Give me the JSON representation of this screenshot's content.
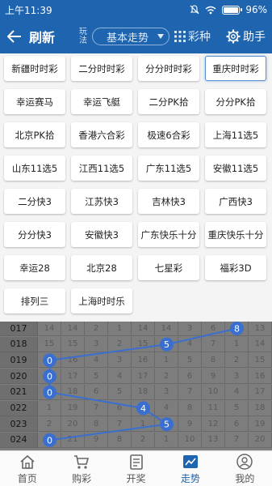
{
  "status_bar": {
    "time": "上午11:39",
    "battery": "96%",
    "battery_level": 0.96
  },
  "nav": {
    "title": "刷新",
    "play_label_top": "玩",
    "play_label_bottom": "法",
    "play_selected": "基本走势",
    "lottery_label": "彩种",
    "helper_label": "助手"
  },
  "lotteries": [
    "新疆时时彩",
    "二分时时彩",
    "分分时时彩",
    "重庆时时彩",
    "幸运赛马",
    "幸运飞艇",
    "二分PK拾",
    "分分PK拾",
    "北京PK拾",
    "香港六合彩",
    "极速6合彩",
    "上海11选5",
    "山东11选5",
    "江西11选5",
    "广东11选5",
    "安徽11选5",
    "二分快3",
    "江苏快3",
    "吉林快3",
    "广西快3",
    "分分快3",
    "安徽快3",
    "广东快乐十分",
    "重庆快乐十分",
    "幸运28",
    "北京28",
    "七星彩",
    "福彩3D",
    "排列三",
    "上海时时乐"
  ],
  "selected_lottery": "重庆时时彩",
  "trend": {
    "rows": [
      {
        "issue": "017",
        "cells": [
          "14",
          "14",
          "2",
          "1",
          "14",
          "14",
          "3",
          "6",
          "8",
          "13"
        ],
        "hit": 8
      },
      {
        "issue": "018",
        "cells": [
          "15",
          "15",
          "3",
          "2",
          "15",
          "5",
          "4",
          "7",
          "1",
          "14"
        ],
        "hit": 5
      },
      {
        "issue": "019",
        "cells": [
          "0",
          "16",
          "4",
          "3",
          "16",
          "1",
          "5",
          "8",
          "2",
          "15"
        ],
        "hit": 0
      },
      {
        "issue": "020",
        "cells": [
          "0",
          "17",
          "5",
          "4",
          "17",
          "2",
          "6",
          "9",
          "3",
          "16"
        ],
        "hit": 0
      },
      {
        "issue": "021",
        "cells": [
          "0",
          "18",
          "6",
          "5",
          "18",
          "3",
          "7",
          "10",
          "4",
          "17"
        ],
        "hit": 0
      },
      {
        "issue": "022",
        "cells": [
          "1",
          "19",
          "7",
          "6",
          "4",
          "4",
          "8",
          "11",
          "5",
          "18"
        ],
        "hit": 4
      },
      {
        "issue": "023",
        "cells": [
          "2",
          "20",
          "8",
          "7",
          "1",
          "5",
          "9",
          "12",
          "6",
          "19"
        ],
        "hit": 5
      },
      {
        "issue": "024",
        "cells": [
          "0",
          "21",
          "9",
          "8",
          "2",
          "1",
          "10",
          "13",
          "7",
          "20"
        ],
        "hit": 0
      }
    ],
    "line_color": "#3a6fd0"
  },
  "tabs": [
    {
      "label": "首页",
      "icon": "home-icon"
    },
    {
      "label": "购彩",
      "icon": "cart-icon"
    },
    {
      "label": "开奖",
      "icon": "draw-icon"
    },
    {
      "label": "走势",
      "icon": "trend-icon",
      "active": true
    },
    {
      "label": "我的",
      "icon": "user-icon"
    }
  ]
}
